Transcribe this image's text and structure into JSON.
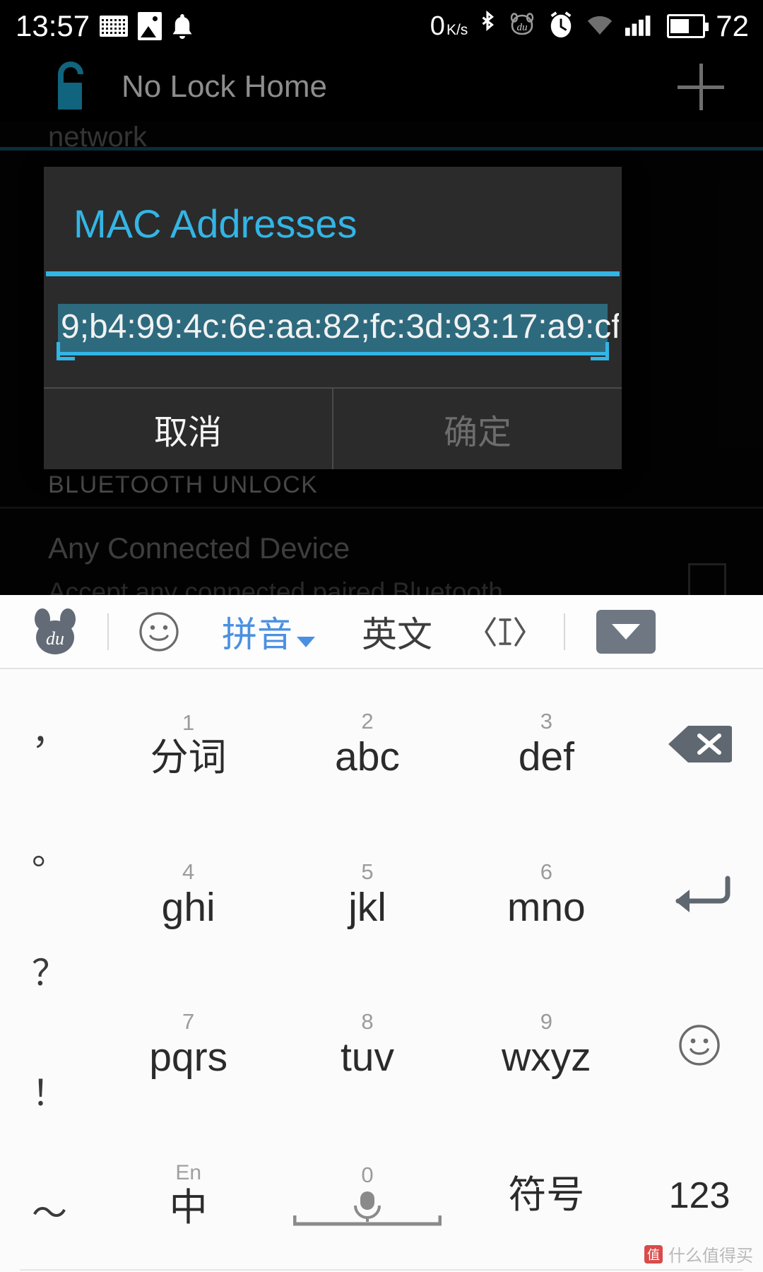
{
  "status_bar": {
    "time": "13:57",
    "left_icons": [
      "keyboard-icon",
      "photo-icon",
      "notification-bell-icon"
    ],
    "net_speed": "0",
    "net_speed_unit": "K/s",
    "right_icons": [
      "bluetooth-icon",
      "baidu-ime-icon",
      "alarm-icon",
      "wifi-icon",
      "signal-icon",
      "battery-icon"
    ],
    "battery_percent": "72"
  },
  "app_bar": {
    "icon": "unlock-icon",
    "title": "No Lock Home",
    "add_label": "+"
  },
  "background": {
    "partial_text": "network",
    "section_header": "BLUETOOTH UNLOCK",
    "row_title": "Any Connected Device",
    "row_subtitle": "Accept any connected paired Bluetooth"
  },
  "dialog": {
    "title": "MAC Addresses",
    "input_value": "9;b4:99:4c:6e:aa:82;fc:3d:93:17:a9:cf",
    "input_selected": true,
    "cancel_label": "取消",
    "ok_label": "确定",
    "accent_color": "#33b5e5",
    "selection_color": "#2e6a7e",
    "surface_color": "#2b2b2b"
  },
  "keyboard": {
    "toolbar": {
      "logo": "baidu-du-icon",
      "emoji": "smiley-icon",
      "mode_pinyin": "拼音",
      "mode_english": "英文",
      "cursor_tool": "cursor-move-icon",
      "collapse": "chevron-down-icon",
      "active_mode_color": "#4a90e2"
    },
    "punct_column": [
      "，",
      "。",
      "？",
      "！",
      "～"
    ],
    "rows": [
      [
        {
          "num": "1",
          "label": "分词"
        },
        {
          "num": "2",
          "label": "abc"
        },
        {
          "num": "3",
          "label": "def"
        }
      ],
      [
        {
          "num": "4",
          "label": "ghi"
        },
        {
          "num": "5",
          "label": "jkl"
        },
        {
          "num": "6",
          "label": "mno"
        }
      ],
      [
        {
          "num": "7",
          "label": "pqrs"
        },
        {
          "num": "8",
          "label": "tuv"
        },
        {
          "num": "9",
          "label": "wxyz"
        }
      ]
    ],
    "bottom_row": [
      {
        "num": "En",
        "label": "中"
      },
      {
        "num": "0",
        "label": "space-mic"
      },
      {
        "num": "",
        "label": "符号"
      }
    ],
    "function_column": [
      "backspace-icon",
      "enter-icon",
      "smiley-icon",
      "123"
    ]
  },
  "watermark": {
    "text": "什么值得买"
  }
}
